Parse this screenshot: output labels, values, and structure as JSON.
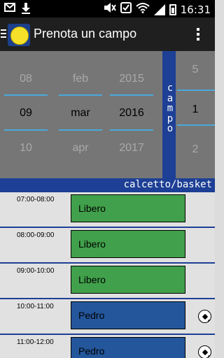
{
  "status_bar": {
    "time": "16:31",
    "icons": [
      "mail-icon",
      "download-icon",
      "mute-icon",
      "settings-alert-icon",
      "wifi-icon",
      "signal-icon",
      "battery-icon"
    ]
  },
  "app_bar": {
    "title": "Prenota un campo",
    "icons": [
      "menu-icon",
      "app-logo",
      "overflow-menu-icon"
    ]
  },
  "date_picker": {
    "day": {
      "prev": "08",
      "selected": "09",
      "next": "10"
    },
    "month": {
      "prev": "feb",
      "selected": "mar",
      "next": "apr"
    },
    "year": {
      "prev": "2015",
      "selected": "2016",
      "next": "2017"
    }
  },
  "field_picker": {
    "label": "campo",
    "prev": "5",
    "selected": "1",
    "next": "2",
    "field_name": "calcetto/basket"
  },
  "schedule": [
    {
      "time": "07:00-08:00",
      "status": "Libero",
      "state": "free",
      "icon": ""
    },
    {
      "time": "08:00-09:00",
      "status": "Libero",
      "state": "free",
      "icon": ""
    },
    {
      "time": "09:00-10:00",
      "status": "Libero",
      "state": "free",
      "icon": ""
    },
    {
      "time": "10:00-11:00",
      "status": "Pedro",
      "state": "booked",
      "icon": "soccer-ball-icon"
    },
    {
      "time": "11:00-12:00",
      "status": "Pedro",
      "state": "booked",
      "icon": "soccer-ball-icon"
    }
  ],
  "colors": {
    "accent_blue": "#1d3f95",
    "free_green": "#41a04b",
    "booked_blue": "#24569b",
    "picker_divider": "#49a9dc"
  }
}
